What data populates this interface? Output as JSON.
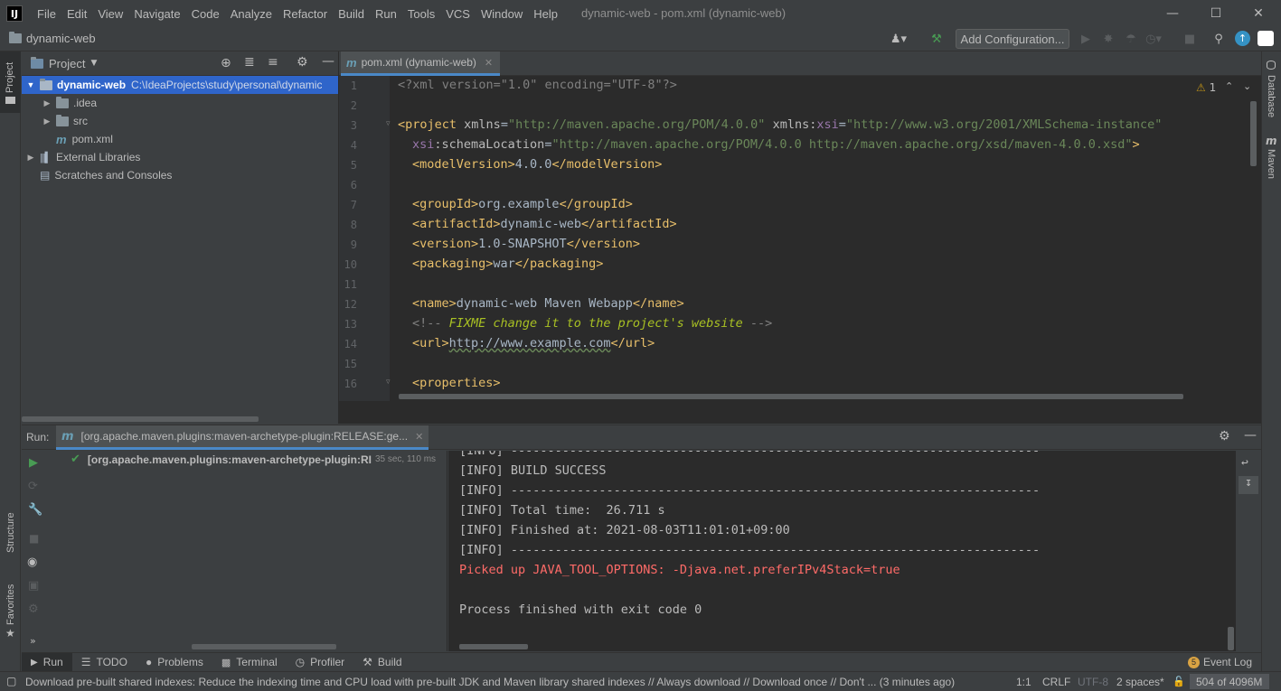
{
  "titlebar": {
    "logo": "IJ",
    "menu": [
      "File",
      "Edit",
      "View",
      "Navigate",
      "Code",
      "Analyze",
      "Refactor",
      "Build",
      "Run",
      "Tools",
      "VCS",
      "Window",
      "Help"
    ],
    "title": "dynamic-web - pom.xml (dynamic-web)"
  },
  "navbar": {
    "project": "dynamic-web",
    "add_configuration": "Add Configuration..."
  },
  "left_strip": {
    "project": "Project",
    "structure": "Structure",
    "favorites": "Favorites"
  },
  "right_strip": {
    "database": "Database",
    "maven": "Maven"
  },
  "project_panel": {
    "title": "Project",
    "root": "dynamic-web",
    "root_path": "C:\\IdeaProjects\\study\\personal\\dynamic",
    "items": [
      ".idea",
      "src",
      "pom.xml",
      "External Libraries",
      "Scratches and Consoles"
    ]
  },
  "editor": {
    "tab": "pom.xml (dynamic-web)",
    "warnings": "1",
    "line_numbers": [
      "1",
      "2",
      "3",
      "4",
      "5",
      "6",
      "7",
      "8",
      "9",
      "10",
      "11",
      "12",
      "13",
      "14",
      "15",
      "16"
    ]
  },
  "code": {
    "l1_decl": "<?xml version=\"1.0\" encoding=\"UTF-8\"?>",
    "l3_open": "<project",
    "l3_attr1": " xmlns",
    "l3_eq": "=",
    "l3_val1": "\"http://maven.apache.org/POM/4.0.0\"",
    "l3_attr2a": " xmlns:",
    "l3_attr2b": "xsi",
    "l3_val2": "\"http://www.w3.org/2001/XMLSchema-instance\"",
    "l4_ns": "xsi",
    "l4_attr": ":schemaLocation",
    "l4_val": "\"http://maven.apache.org/POM/4.0.0 http://maven.apache.org/xsd/maven-4.0.0.xsd\"",
    "l4_close": ">",
    "l5_open": "<modelVersion>",
    "l5_text": "4.0.0",
    "l5_close": "</modelVersion>",
    "l7_open": "<groupId>",
    "l7_text": "org.example",
    "l7_close": "</groupId>",
    "l8_open": "<artifactId>",
    "l8_text": "dynamic-web",
    "l8_close": "</artifactId>",
    "l9_open": "<version>",
    "l9_text": "1.0-SNAPSHOT",
    "l9_close": "</version>",
    "l10_open": "<packaging>",
    "l10_text": "war",
    "l10_close": "</packaging>",
    "l12_open": "<name>",
    "l12_text": "dynamic-web Maven Webapp",
    "l12_close": "</name>",
    "l13_start": "<!-- ",
    "l13_text": "FIXME change it to the project's website",
    "l13_end": " -->",
    "l14_open": "<url>",
    "l14_text": "http://www.example.com",
    "l14_close": "</url>",
    "l16_open": "<properties>"
  },
  "run_panel": {
    "label": "Run:",
    "tab": "[org.apache.maven.plugins:maven-archetype-plugin:RELEASE:ge...",
    "tree_item": "[org.apache.maven.plugins:maven-archetype-plugin:RI",
    "duration": "35 sec, 110 ms",
    "console": [
      "[INFO] ------------------------------------------------------------------------",
      "[INFO] BUILD SUCCESS",
      "[INFO] ------------------------------------------------------------------------",
      "[INFO] Total time:  26.711 s",
      "[INFO] Finished at: 2021-08-03T11:01:01+09:00",
      "[INFO] ------------------------------------------------------------------------",
      "Picked up JAVA_TOOL_OPTIONS: -Djava.net.preferIPv4Stack=true",
      "",
      "Process finished with exit code 0"
    ]
  },
  "bottom_tabs": {
    "run": "Run",
    "todo": "TODO",
    "problems": "Problems",
    "terminal": "Terminal",
    "profiler": "Profiler",
    "build": "Build",
    "event_log": "Event Log",
    "event_count": "5"
  },
  "status": {
    "message": "Download pre-built shared indexes: Reduce the indexing time and CPU load with pre-built JDK and Maven library shared indexes // Always download // Download once // Don't ... (3 minutes ago)",
    "position": "1:1",
    "line_sep": "CRLF",
    "encoding": "UTF-8",
    "indent": "2 spaces*",
    "memory": "504 of 4096M"
  },
  "colors": {
    "accent": "#2f65ca",
    "success": "#499c54",
    "error": "#ff6b68",
    "tag": "#e8bf6a",
    "string": "#6a8759"
  }
}
